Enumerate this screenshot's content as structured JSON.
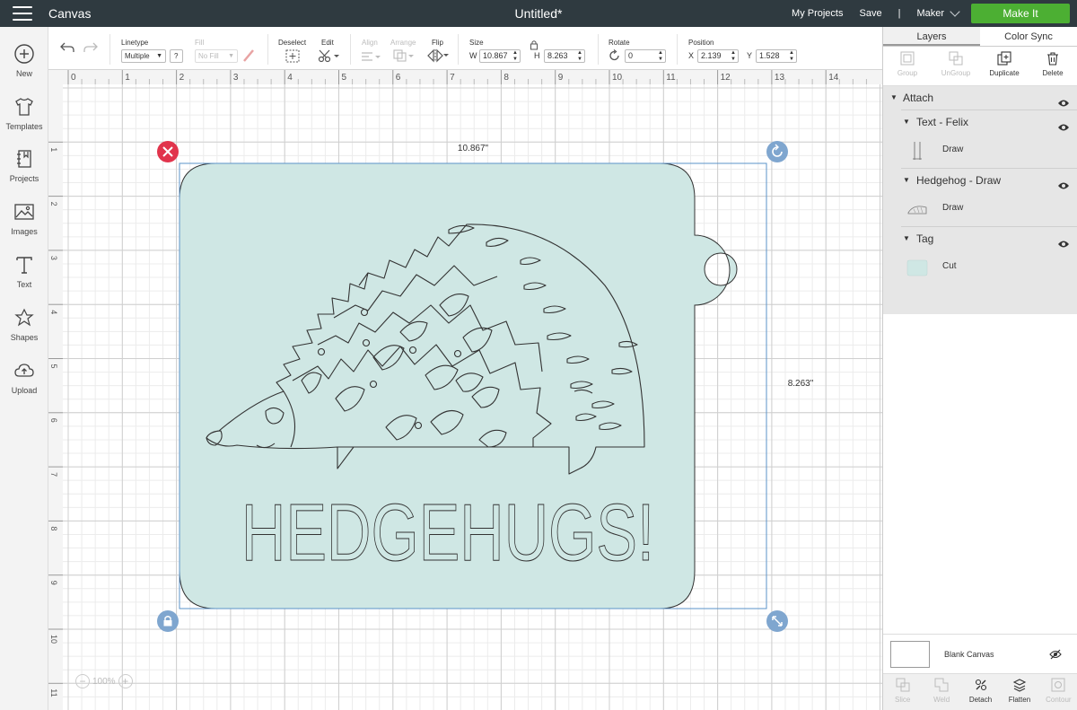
{
  "topbar": {
    "app_name": "Canvas",
    "document_title": "Untitled*",
    "my_projects": "My Projects",
    "save": "Save",
    "separator": "|",
    "machine": "Maker",
    "make_it": "Make It",
    "make_it_color": "#4caf33"
  },
  "leftbar": {
    "items": [
      {
        "label": "New",
        "icon": "plus-circle-icon"
      },
      {
        "label": "Templates",
        "icon": "tshirt-icon"
      },
      {
        "label": "Projects",
        "icon": "notebook-icon"
      },
      {
        "label": "Images",
        "icon": "image-icon"
      },
      {
        "label": "Text",
        "icon": "text-t-icon"
      },
      {
        "label": "Shapes",
        "icon": "shapes-icon"
      },
      {
        "label": "Upload",
        "icon": "cloud-upload-icon"
      }
    ]
  },
  "toolbar": {
    "linetype_label": "Linetype",
    "linetype_value": "Multiple",
    "linetype_help": "?",
    "fill_label": "Fill",
    "fill_value": "No Fill",
    "deselect_label": "Deselect",
    "edit_label": "Edit",
    "align_label": "Align",
    "arrange_label": "Arrange",
    "flip_label": "Flip",
    "size_label": "Size",
    "w_label": "W",
    "w_value": "10.867",
    "h_label": "H",
    "h_value": "8.263",
    "rotate_label": "Rotate",
    "rotate_value": "0",
    "position_label": "Position",
    "x_label": "X",
    "x_value": "2.139",
    "y_label": "Y",
    "y_value": "1.528"
  },
  "canvas": {
    "ruler_top": [
      "0",
      "1",
      "2",
      "3",
      "4",
      "5",
      "6",
      "7",
      "8",
      "9",
      "10",
      "11",
      "12",
      "13",
      "14"
    ],
    "ruler_left": [
      "1",
      "2",
      "3",
      "4",
      "5",
      "6",
      "7",
      "8",
      "9",
      "10",
      "11"
    ],
    "width_readout": "10.867\"",
    "height_readout": "8.263\"",
    "tag_color": "#cfe7e4",
    "design_text": "HEDGEHUGS!",
    "zoom_value": "100%"
  },
  "rightpanel": {
    "tabs": [
      "Layers",
      "Color Sync"
    ],
    "actions": [
      {
        "label": "Group",
        "enabled": false
      },
      {
        "label": "UnGroup",
        "enabled": false
      },
      {
        "label": "Duplicate",
        "enabled": true
      },
      {
        "label": "Delete",
        "enabled": true
      }
    ],
    "layers": {
      "root": "Attach",
      "text_group": "Text - Felix",
      "text_child": "Draw",
      "hedgehog_group": "Hedgehog - Draw",
      "hedgehog_child": "Draw",
      "tag_group": "Tag",
      "tag_child": "Cut"
    },
    "blank_canvas": "Blank Canvas",
    "bottom_actions": [
      {
        "label": "Slice",
        "enabled": false
      },
      {
        "label": "Weld",
        "enabled": false
      },
      {
        "label": "Detach",
        "enabled": true
      },
      {
        "label": "Flatten",
        "enabled": true
      },
      {
        "label": "Contour",
        "enabled": false
      }
    ]
  }
}
